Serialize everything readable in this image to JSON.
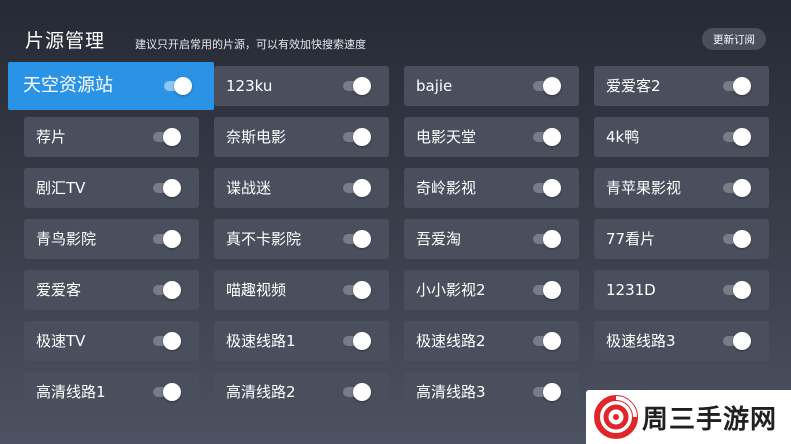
{
  "header": {
    "title": "片源管理",
    "hint": "建议只开启常用的片源，可以有效加快搜索速度",
    "update_button": "更新订阅"
  },
  "sources": [
    [
      "天空资源站",
      "123ku",
      "bajie",
      "爱爱客2"
    ],
    [
      "荐片",
      "奈斯电影",
      "电影天堂",
      "4k鸭"
    ],
    [
      "剧汇TV",
      "谍战迷",
      "奇岭影视",
      "青苹果影视"
    ],
    [
      "青鸟影院",
      "真不卡影院",
      "吾爱淘",
      "77看片"
    ],
    [
      "爱爱客",
      "喵趣视频",
      "小小影视2",
      "1231D"
    ],
    [
      "极速TV",
      "极速线路1",
      "极速线路2",
      "极速线路3"
    ],
    [
      "高清线路1",
      "高清线路2",
      "高清线路3"
    ]
  ],
  "selected": "天空资源站",
  "all_enabled": true,
  "watermark": {
    "text": "周三手游网"
  },
  "colors": {
    "accent": "#2a93e6",
    "card": "#4a4f5d",
    "toggle_on_knob": "#ffffff",
    "watermark_red": "#e0262b"
  }
}
